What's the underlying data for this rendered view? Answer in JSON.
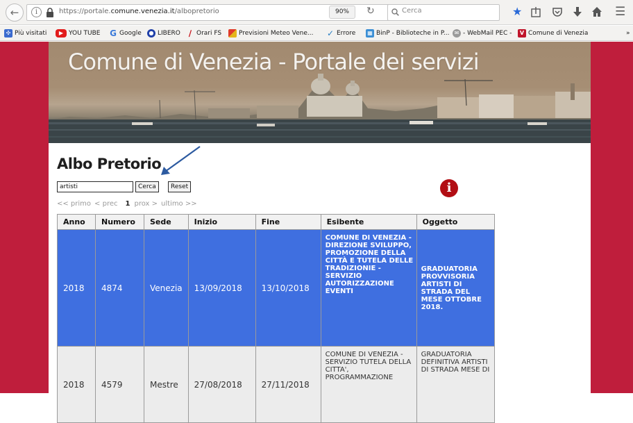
{
  "browser": {
    "url_prefix": "https://portale.",
    "url_domain": "comune.venezia.it",
    "url_path": "/albopretorio",
    "zoom": "90%",
    "search_placeholder": "Cerca"
  },
  "bookmarks": [
    {
      "label": "Più visitati",
      "icon": "firefox-icon",
      "color": "#3b6bcf"
    },
    {
      "label": "YOU TUBE",
      "icon": "youtube-icon",
      "color": "#e21b1b"
    },
    {
      "label": "Google",
      "icon": "google-icon",
      "color": "#3b7ad9"
    },
    {
      "label": "LIBERO",
      "icon": "libero-icon",
      "color": "#1f3fa8"
    },
    {
      "label": "Orari FS",
      "icon": "trenitalia-icon",
      "color": "#c7161d"
    },
    {
      "label": "Previsioni Meteo Vene...",
      "icon": "meteo-icon",
      "color": "#e59a1a"
    },
    {
      "label": "Errore",
      "icon": "error-icon",
      "color": "#2a7fc4"
    },
    {
      "label": "BinP - Biblioteche in P...",
      "icon": "library-icon",
      "color": "#3c8fd5"
    },
    {
      "label": "- WebMail PEC -",
      "icon": "webmail-icon",
      "color": "#8a8a8a"
    },
    {
      "label": "Comune di Venezia",
      "icon": "comune-icon",
      "color": "#c0152b"
    }
  ],
  "page": {
    "banner_title": "Comune di Venezia - Portale dei servizi",
    "title": "Albo Pretorio",
    "search_value": "artisti",
    "search_button": "Cerca",
    "reset_button": "Reset",
    "pager": {
      "first": "<< primo",
      "prev": "< prec",
      "current": "1",
      "next": "prox >",
      "last": "ultimo >>"
    },
    "info_glyph": "i"
  },
  "table": {
    "columns": [
      "Anno",
      "Numero",
      "Sede",
      "Inizio",
      "Fine",
      "Esibente",
      "Oggetto"
    ],
    "rows": [
      {
        "anno": "2018",
        "numero": "4874",
        "sede": "Venezia",
        "inizio": "13/09/2018",
        "fine": "13/10/2018",
        "esibente": "COMUNE DI VENEZIA - DIREZIONE SVILUPPO, PROMOZIONE DELLA CITTÀ E TUTELA DELLE TRADIZIONIE - SERVIZIO AUTORIZZAZIONE EVENTI",
        "oggetto": "GRADUATORIA PROVVISORIA ARTISTI DI STRADA DEL MESE OTTOBRE 2018."
      },
      {
        "anno": "2018",
        "numero": "4579",
        "sede": "Mestre",
        "inizio": "27/08/2018",
        "fine": "27/11/2018",
        "esibente": "COMUNE DI VENEZIA - SERVIZIO TUTELA DELLA CITTA', PROGRAMMAZIONE",
        "oggetto": "GRADUATORIA DEFINITIVA ARTISTI DI STRADA MESE DI"
      }
    ]
  },
  "colors": {
    "page_bg": "#bf1e3c",
    "selected_row": "#3f6fe0",
    "info_icon": "#b20e14"
  }
}
